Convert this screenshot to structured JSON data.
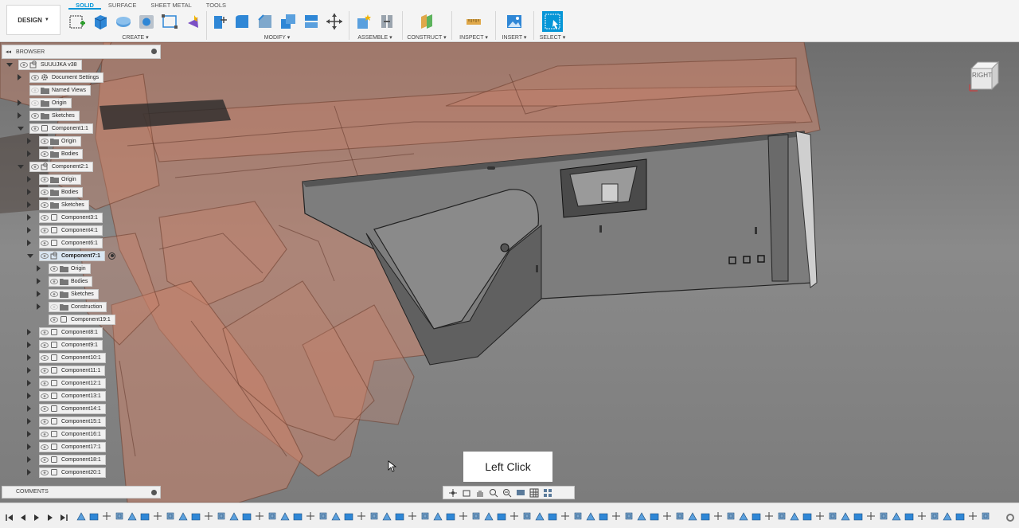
{
  "workspace": {
    "label": "DESIGN"
  },
  "tabs": [
    "SOLID",
    "SURFACE",
    "SHEET METAL",
    "TOOLS"
  ],
  "active_tab": "SOLID",
  "toolbar_groups": {
    "create": "CREATE ▾",
    "modify": "MODIFY ▾",
    "assemble": "ASSEMBLE ▾",
    "construct": "CONSTRUCT ▾",
    "inspect": "INSPECT ▾",
    "insert": "INSERT ▾",
    "select": "SELECT ▾"
  },
  "browser": {
    "title": "BROWSER",
    "root": "SUUUJKA v38",
    "items": [
      {
        "label": "Document Settings",
        "icon": "gear-icon"
      },
      {
        "label": "Named Views",
        "icon": "folder-icon"
      },
      {
        "label": "Origin",
        "icon": "folder-icon"
      },
      {
        "label": "Sketches",
        "icon": "folder-icon"
      },
      {
        "label": "Component1:1",
        "icon": "component-icon"
      },
      {
        "label": "Origin",
        "icon": "folder-icon"
      },
      {
        "label": "Bodies",
        "icon": "folder-icon"
      },
      {
        "label": "Component2:1",
        "icon": "component-link-icon"
      },
      {
        "label": "Origin",
        "icon": "folder-icon"
      },
      {
        "label": "Bodies",
        "icon": "folder-icon"
      },
      {
        "label": "Sketches",
        "icon": "folder-icon"
      },
      {
        "label": "Component3:1",
        "icon": "component-icon"
      },
      {
        "label": "Component4:1",
        "icon": "component-icon"
      },
      {
        "label": "Component6:1",
        "icon": "component-icon"
      },
      {
        "label": "Component7:1",
        "icon": "component-link-icon"
      },
      {
        "label": "Origin",
        "icon": "folder-icon"
      },
      {
        "label": "Bodies",
        "icon": "folder-icon"
      },
      {
        "label": "Sketches",
        "icon": "folder-icon"
      },
      {
        "label": "Construction",
        "icon": "folder-icon"
      },
      {
        "label": "Component19:1",
        "icon": "component-icon"
      },
      {
        "label": "Component8:1",
        "icon": "component-icon"
      },
      {
        "label": "Component9:1",
        "icon": "component-icon"
      },
      {
        "label": "Component10:1",
        "icon": "component-icon"
      },
      {
        "label": "Component11:1",
        "icon": "component-icon"
      },
      {
        "label": "Component12:1",
        "icon": "component-icon"
      },
      {
        "label": "Component13:1",
        "icon": "component-icon"
      },
      {
        "label": "Component14:1",
        "icon": "component-icon"
      },
      {
        "label": "Component15:1",
        "icon": "component-icon"
      },
      {
        "label": "Component16:1",
        "icon": "component-icon"
      },
      {
        "label": "Component17:1",
        "icon": "component-icon"
      },
      {
        "label": "Component18:1",
        "icon": "component-icon"
      },
      {
        "label": "Component20:1",
        "icon": "component-icon"
      }
    ]
  },
  "viewcube": {
    "face": "RIGHT"
  },
  "comments": {
    "title": "COMMENTS"
  },
  "overlay": {
    "text": "Left Click"
  },
  "colors": {
    "accent": "#0696d7",
    "transparent_body": "#c9826a",
    "solid_body": "#7d7d7d"
  }
}
